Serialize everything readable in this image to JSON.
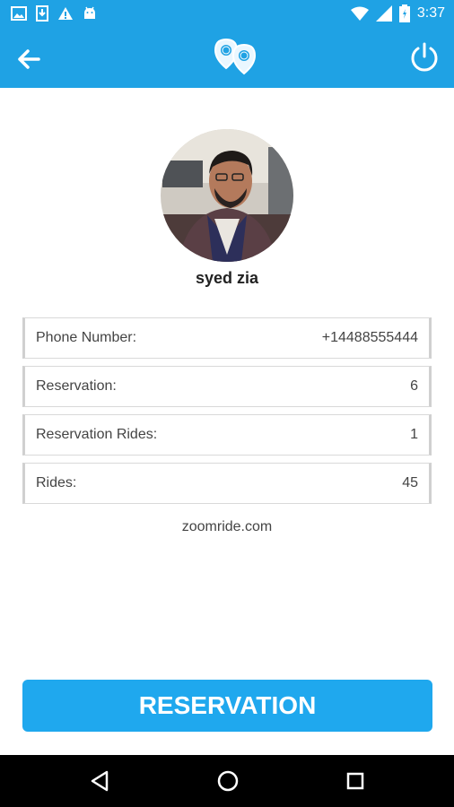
{
  "status_bar": {
    "time": "3:37",
    "left_icons": [
      "image-icon",
      "download-icon",
      "warning-icon",
      "android-icon"
    ],
    "right_icons": [
      "wifi-icon",
      "signal-icon",
      "battery-icon"
    ]
  },
  "toolbar": {
    "back_icon": "arrow-left-icon",
    "logo_icon": "location-pins-logo",
    "power_icon": "power-icon"
  },
  "profile": {
    "name": "syed zia"
  },
  "info_rows": [
    {
      "label": "Phone Number:",
      "value": "+14488555444"
    },
    {
      "label": "Reservation:",
      "value": "6"
    },
    {
      "label": "Reservation Rides:",
      "value": "1"
    },
    {
      "label": "Rides:",
      "value": "45"
    }
  ],
  "website": "zoomride.com",
  "reservation_button": "RESERVATION",
  "colors": {
    "primary": "#1fa2e4",
    "button": "#1fa8ee",
    "nav_bar": "#000000"
  },
  "nav_bar": {
    "icons": [
      "back-triangle-icon",
      "home-circle-icon",
      "recents-square-icon"
    ]
  }
}
